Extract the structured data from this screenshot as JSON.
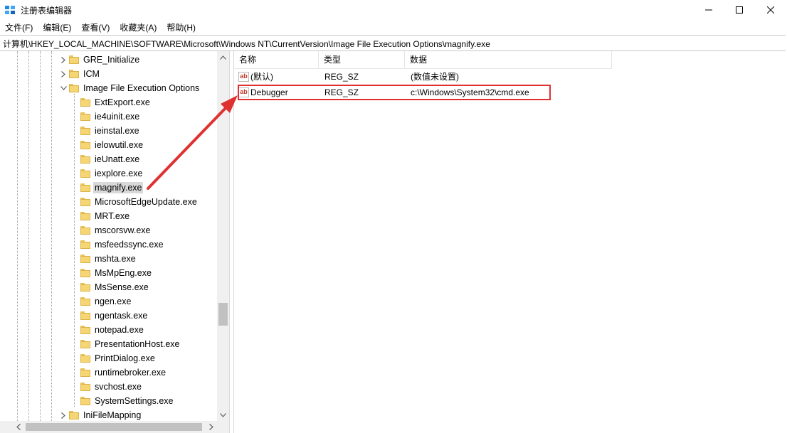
{
  "window": {
    "title": "注册表编辑器",
    "accent": "#1e88e5",
    "buttons": [
      "minimize-icon",
      "maximize-icon",
      "close-icon"
    ]
  },
  "menu": [
    "文件(F)",
    "编辑(E)",
    "查看(V)",
    "收藏夹(A)",
    "帮助(H)"
  ],
  "address": "计算机\\HKEY_LOCAL_MACHINE\\SOFTWARE\\Microsoft\\Windows NT\\CurrentVersion\\Image File Execution Options\\magnify.exe",
  "tree": {
    "items": [
      {
        "label": "GRE_Initialize",
        "expander": "collapsed",
        "level": 1
      },
      {
        "label": "ICM",
        "expander": "collapsed",
        "level": 1
      },
      {
        "label": "Image File Execution Options",
        "expander": "expanded",
        "level": 1
      },
      {
        "label": "ExtExport.exe",
        "expander": "none",
        "level": 2
      },
      {
        "label": "ie4uinit.exe",
        "expander": "none",
        "level": 2
      },
      {
        "label": "ieinstal.exe",
        "expander": "none",
        "level": 2
      },
      {
        "label": "ielowutil.exe",
        "expander": "none",
        "level": 2
      },
      {
        "label": "ieUnatt.exe",
        "expander": "none",
        "level": 2
      },
      {
        "label": "iexplore.exe",
        "expander": "none",
        "level": 2
      },
      {
        "label": "magnify.exe",
        "expander": "none",
        "level": 2,
        "selected": true
      },
      {
        "label": "MicrosoftEdgeUpdate.exe",
        "expander": "none",
        "level": 2
      },
      {
        "label": "MRT.exe",
        "expander": "none",
        "level": 2
      },
      {
        "label": "mscorsvw.exe",
        "expander": "none",
        "level": 2
      },
      {
        "label": "msfeedssync.exe",
        "expander": "none",
        "level": 2
      },
      {
        "label": "mshta.exe",
        "expander": "none",
        "level": 2
      },
      {
        "label": "MsMpEng.exe",
        "expander": "none",
        "level": 2
      },
      {
        "label": "MsSense.exe",
        "expander": "none",
        "level": 2
      },
      {
        "label": "ngen.exe",
        "expander": "none",
        "level": 2
      },
      {
        "label": "ngentask.exe",
        "expander": "none",
        "level": 2
      },
      {
        "label": "notepad.exe",
        "expander": "none",
        "level": 2
      },
      {
        "label": "PresentationHost.exe",
        "expander": "none",
        "level": 2
      },
      {
        "label": "PrintDialog.exe",
        "expander": "none",
        "level": 2
      },
      {
        "label": "runtimebroker.exe",
        "expander": "none",
        "level": 2
      },
      {
        "label": "svchost.exe",
        "expander": "none",
        "level": 2
      },
      {
        "label": "SystemSettings.exe",
        "expander": "none",
        "level": 2
      },
      {
        "label": "IniFileMapping",
        "expander": "collapsed",
        "level": 1
      }
    ]
  },
  "list": {
    "columns": [
      "名称",
      "类型",
      "数据"
    ],
    "rows": [
      {
        "name": "(默认)",
        "type": "REG_SZ",
        "data": "(数值未设置)",
        "icon": "string-value-icon"
      },
      {
        "name": "Debugger",
        "type": "REG_SZ",
        "data": "c:\\Windows\\System32\\cmd.exe",
        "icon": "string-value-icon",
        "highlighted": true
      }
    ]
  },
  "annotation": {
    "color": "#e03131",
    "icon": "arrow-annotation",
    "box": "highlight-box"
  }
}
